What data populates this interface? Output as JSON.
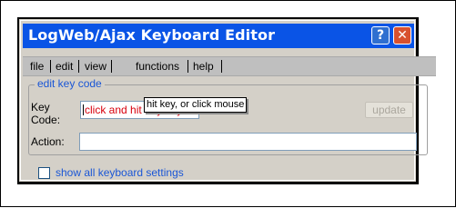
{
  "window": {
    "title": "LogWeb/Ajax Keyboard Editor",
    "help_button": "?",
    "close_button": "✕",
    "titlebar_color": "#0a54e6"
  },
  "menu": {
    "items": [
      "file",
      "edit",
      "view",
      "functions",
      "help"
    ]
  },
  "edit_group": {
    "legend": "edit key code",
    "key_code_label_line1": "Key",
    "key_code_label_line2": "Code:",
    "key_code_value": "click and hit any key",
    "update_button": "update",
    "action_label": "Action:",
    "action_value": ""
  },
  "tooltip": {
    "text": "hit key, or click mouse"
  },
  "options": {
    "show_all_label": "show all keyboard settings",
    "show_all_checked": false
  }
}
